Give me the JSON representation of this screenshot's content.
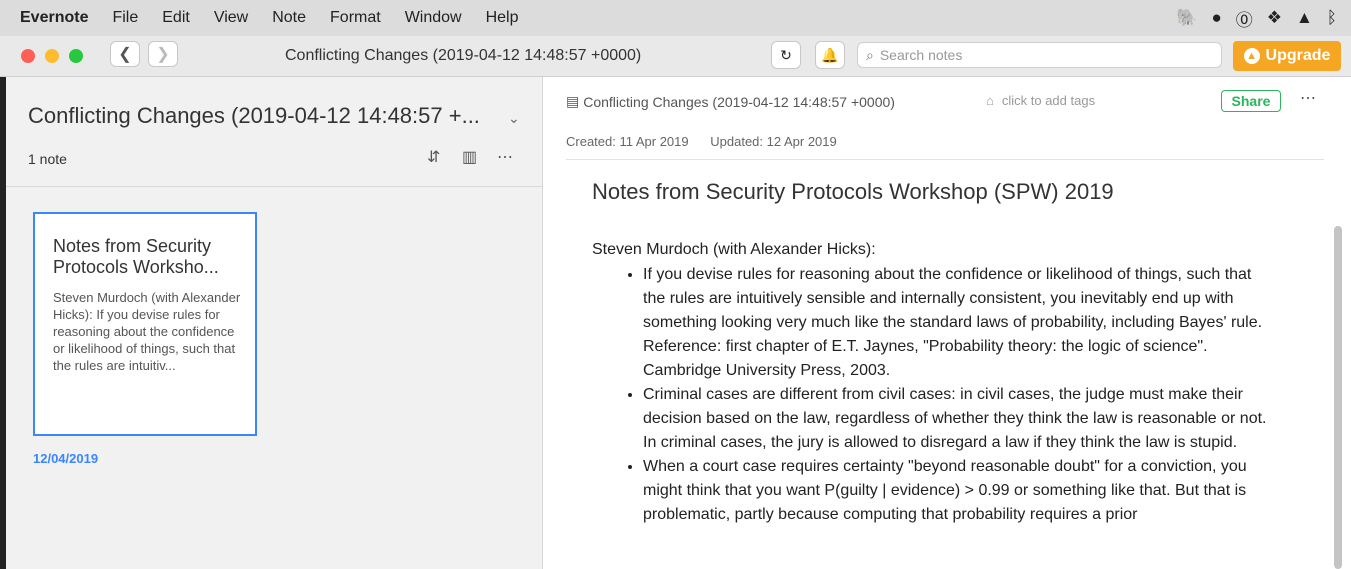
{
  "menubar": {
    "app": "Evernote",
    "items": [
      "File",
      "Edit",
      "View",
      "Note",
      "Format",
      "Window",
      "Help"
    ],
    "status_icons": [
      "evernote-elephant-icon",
      "dark-mode-icon",
      "onepassword-icon",
      "dropbox-icon",
      "hat-icon",
      "bluetooth-icon"
    ]
  },
  "titlebar": {
    "title": "Conflicting Changes (2019-04-12 14:48:57 +0000)",
    "search_placeholder": "Search notes",
    "upgrade_label": "Upgrade",
    "traffic_colors": [
      "#fe5f57",
      "#febc2e",
      "#28c840"
    ]
  },
  "notelist": {
    "notebook_title": "Conflicting Changes (2019-04-12 14:48:57 +...",
    "note_count": "1 note",
    "notes": [
      {
        "title": "Notes from Security Protocols Worksho...",
        "snippet": "Steven Murdoch (with Alexander Hicks): If you devise rules for reasoning about the confidence or likelihood of things, such that the rules are intuitiv...",
        "date": "12/04/2019"
      }
    ]
  },
  "editor": {
    "notebook": "Conflicting Changes (2019-04-12 14:48:57 +0000)",
    "tags_placeholder": "click to add tags",
    "share_label": "Share",
    "created": "Created: 11 Apr 2019",
    "updated": "Updated: 12 Apr 2019",
    "note_title": "Notes from Security Protocols Workshop (SPW) 2019",
    "lead": "Steven Murdoch (with Alexander Hicks):",
    "bullets": [
      "If you devise rules for reasoning about the confidence or likelihood of things, such that the rules are intuitively sensible and internally consistent, you inevitably end up with something looking very much like the standard laws of probability, including Bayes' rule. Reference: first chapter of E.T. Jaynes, \"Probability theory: the logic of science\". Cambridge University Press, 2003.",
      "Criminal cases are different from civil cases: in civil cases, the judge must make their decision based on the law, regardless of whether they think the law is reasonable or not. In criminal cases, the jury is allowed to disregard a law if they think the law is stupid.",
      "When a court case requires certainty \"beyond reasonable doubt\" for a conviction, you might think that you want P(guilty | evidence) > 0.99 or something like that. But that is problematic, partly because computing that probability requires a prior"
    ]
  },
  "colors": {
    "accent": "#3a86ff",
    "upgrade": "#f5a623",
    "share": "#2db55d"
  }
}
